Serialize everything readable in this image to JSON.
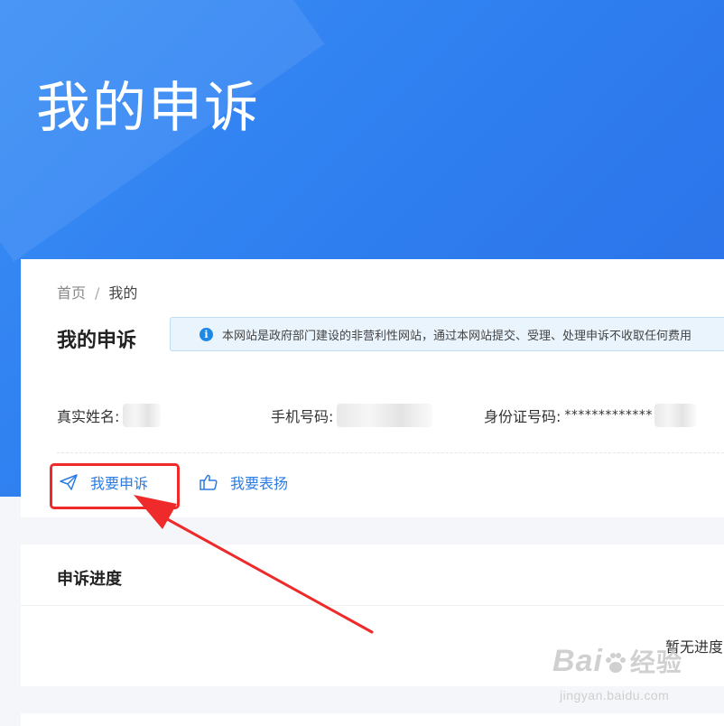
{
  "hero": {
    "title": "我的申诉"
  },
  "breadcrumb": {
    "home": "首页",
    "separator": "/",
    "current": "我的"
  },
  "section": {
    "title": "我的申诉"
  },
  "notice": {
    "icon": "info-icon",
    "text": "本网站是政府部门建设的非营利性网站，通过本网站提交、受理、处理申诉不收取任何费用"
  },
  "user_info": {
    "name_label": "真实姓名:",
    "phone_label": "手机号码:",
    "idcard_label": "身份证号码:",
    "idcard_value": "*************"
  },
  "actions": {
    "complain_label": "我要申诉",
    "complain_icon": "paper-plane-icon",
    "praise_label": "我要表扬",
    "praise_icon": "thumbs-up-icon"
  },
  "progress": {
    "title": "申诉进度",
    "empty_text": "暂无进度"
  },
  "watermark": {
    "logo": "Bai",
    "logo_suffix": "经验",
    "url": "jingyan.baidu.com"
  },
  "colors": {
    "hero_blue": "#2f7ff0",
    "link_blue": "#2a7be4",
    "annotation_red": "#ee2a2a",
    "notice_bg": "#eaf4fd"
  }
}
